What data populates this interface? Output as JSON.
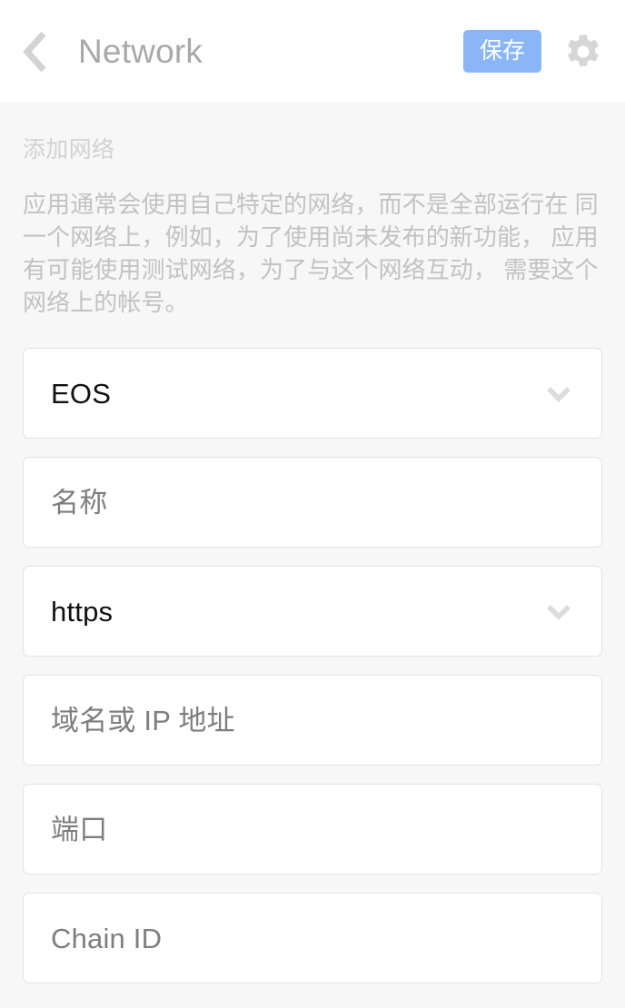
{
  "header": {
    "back_icon": "chevron-left-icon",
    "title": "Network",
    "save_label": "保存",
    "settings_icon": "gear-icon",
    "save_bg_color": "#8ab6f8",
    "title_color": "#a9a9a9"
  },
  "content": {
    "section_heading": "添加网络",
    "section_description": "应用通常会使用自己特定的网络，而不是全部运行在 同一个网络上，例如，为了使用尚未发布的新功能， 应用有可能使用测试网络，为了与这个网络互动， 需要这个网络上的帐号。"
  },
  "form": {
    "fields": [
      {
        "name": "blockchain-type",
        "text": "EOS",
        "kind": "value",
        "has_chevron": true
      },
      {
        "name": "network-name",
        "text": "名称",
        "kind": "placeholder",
        "has_chevron": false
      },
      {
        "name": "protocol",
        "text": "https",
        "kind": "value",
        "has_chevron": true
      },
      {
        "name": "host",
        "text": "域名或 IP 地址",
        "kind": "placeholder",
        "has_chevron": false
      },
      {
        "name": "port",
        "text": "端口",
        "kind": "placeholder",
        "has_chevron": false
      },
      {
        "name": "chain-id",
        "text": "Chain ID",
        "kind": "placeholder",
        "has_chevron": false
      }
    ]
  }
}
